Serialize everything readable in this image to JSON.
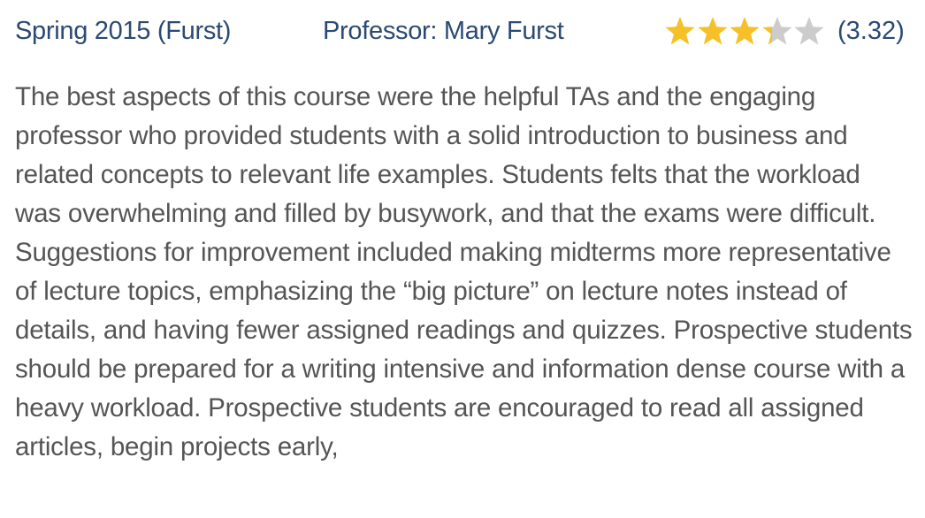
{
  "header": {
    "term": "Spring 2015 (Furst)",
    "professor": "Professor: Mary Furst",
    "rating": {
      "value": 3.32,
      "max": 5,
      "label": "(3.32)"
    }
  },
  "review": {
    "text": "The best aspects of this course were the helpful TAs and the engaging professor who provided students with a solid introduction to business and related concepts to relevant life examples. Students felts that the workload was overwhelming and filled by busywork, and that the exams were difficult. Suggestions for improvement included making midterms more representative of lecture topics, emphasizing the “big picture” on lecture notes instead of details, and having fewer assigned readings and quizzes. Prospective students should be prepared for a writing intensive and information dense course with a heavy workload. Prospective students are encouraged to read all assigned articles, begin projects early,"
  },
  "colors": {
    "heading": "#2b4a73",
    "body_text": "#555555",
    "star_filled": "#f5c028",
    "star_empty": "#cccccc"
  },
  "icons": {
    "star": "star-icon"
  }
}
